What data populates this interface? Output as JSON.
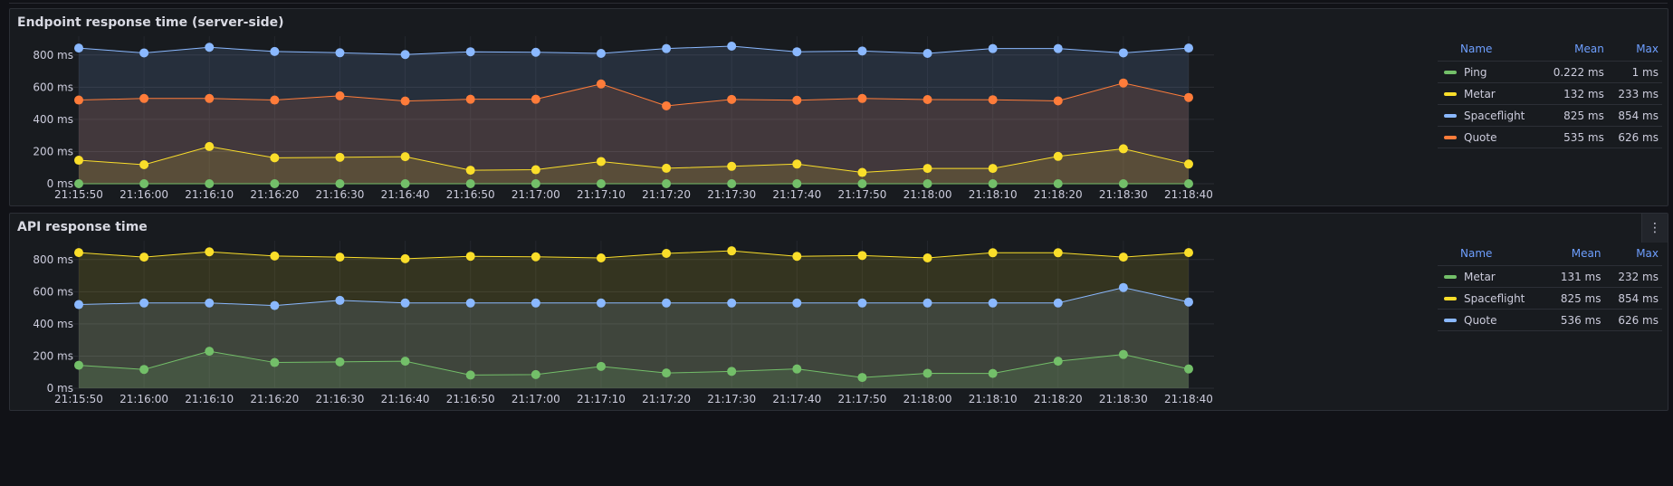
{
  "panels": [
    {
      "title": "Endpoint response time (server-side)",
      "has_menu": false,
      "legend": {
        "headers": {
          "name": "Name",
          "mean": "Mean",
          "max": "Max"
        },
        "rows": [
          {
            "name": "Ping",
            "mean": "0.222 ms",
            "max": "1 ms",
            "color": "#73bf69"
          },
          {
            "name": "Metar",
            "mean": "132 ms",
            "max": "233 ms",
            "color": "#fade2a"
          },
          {
            "name": "Spaceflight",
            "mean": "825 ms",
            "max": "854 ms",
            "color": "#8ab8ff"
          },
          {
            "name": "Quote",
            "mean": "535 ms",
            "max": "626 ms",
            "color": "#ff7c3a"
          }
        ]
      },
      "chart_data": {
        "type": "line",
        "x": [
          "21:15:50",
          "21:16:00",
          "21:16:10",
          "21:16:20",
          "21:16:30",
          "21:16:40",
          "21:16:50",
          "21:17:00",
          "21:17:10",
          "21:17:20",
          "21:17:30",
          "21:17:40",
          "21:17:50",
          "21:18:00",
          "21:18:10",
          "21:18:20",
          "21:18:30",
          "21:18:40"
        ],
        "y_ticks": [
          "0 ms",
          "200 ms",
          "400 ms",
          "600 ms",
          "800 ms"
        ],
        "ylim": [
          0,
          900
        ],
        "series": [
          {
            "name": "Spaceflight",
            "color": "#8ab8ff",
            "values": [
              843,
              813,
              848,
              822,
              814,
              803,
              820,
              817,
              810,
              840,
              855,
              820,
              825,
              810,
              840,
              840,
              813,
              843
            ]
          },
          {
            "name": "Quote",
            "color": "#ff7c3a",
            "values": [
              520,
              530,
              530,
              520,
              546,
              514,
              525,
              525,
              620,
              484,
              524,
              519,
              530,
              523,
              522,
              515,
              626,
              536
            ]
          },
          {
            "name": "Metar",
            "color": "#fade2a",
            "values": [
              146,
              118,
              231,
              161,
              164,
              168,
              84,
              87,
              138,
              96,
              108,
              122,
              70,
              95,
              95,
              170,
              217,
              122
            ]
          },
          {
            "name": "Ping",
            "color": "#73bf69",
            "values": [
              0,
              0,
              0,
              0,
              0,
              0,
              0,
              0,
              0,
              0,
              0,
              0,
              0,
              0,
              0,
              0,
              0,
              0
            ]
          }
        ]
      }
    },
    {
      "title": "API response time",
      "has_menu": true,
      "menu_icon": "⋮",
      "legend": {
        "headers": {
          "name": "Name",
          "mean": "Mean",
          "max": "Max"
        },
        "rows": [
          {
            "name": "Metar",
            "mean": "131 ms",
            "max": "232 ms",
            "color": "#73bf69"
          },
          {
            "name": "Spaceflight",
            "mean": "825 ms",
            "max": "854 ms",
            "color": "#fade2a"
          },
          {
            "name": "Quote",
            "mean": "536 ms",
            "max": "626 ms",
            "color": "#8ab8ff"
          }
        ]
      },
      "chart_data": {
        "type": "line",
        "x": [
          "21:15:50",
          "21:16:00",
          "21:16:10",
          "21:16:20",
          "21:16:30",
          "21:16:40",
          "21:16:50",
          "21:17:00",
          "21:17:10",
          "21:17:20",
          "21:17:30",
          "21:17:40",
          "21:17:50",
          "21:18:00",
          "21:18:10",
          "21:18:20",
          "21:18:30",
          "21:18:40"
        ],
        "y_ticks": [
          "0 ms",
          "200 ms",
          "400 ms",
          "600 ms",
          "800 ms"
        ],
        "ylim": [
          0,
          900
        ],
        "series": [
          {
            "name": "Spaceflight",
            "color": "#fade2a",
            "values": [
              843,
              815,
              848,
              822,
              815,
              805,
              820,
              817,
              810,
              838,
              854,
              820,
              825,
              810,
              842,
              842,
              815,
              843
            ]
          },
          {
            "name": "Quote",
            "color": "#8ab8ff",
            "values": [
              520,
              530,
              530,
              514,
              546,
              530,
              530,
              530,
              530,
              530,
              530,
              530,
              530,
              530,
              530,
              530,
              626,
              536
            ]
          },
          {
            "name": "Metar",
            "color": "#73bf69",
            "values": [
              143,
              117,
              230,
              160,
              164,
              168,
              82,
              85,
              136,
              95,
              105,
              120,
              67,
              93,
              92,
              168,
              210,
              120
            ]
          }
        ]
      }
    }
  ]
}
